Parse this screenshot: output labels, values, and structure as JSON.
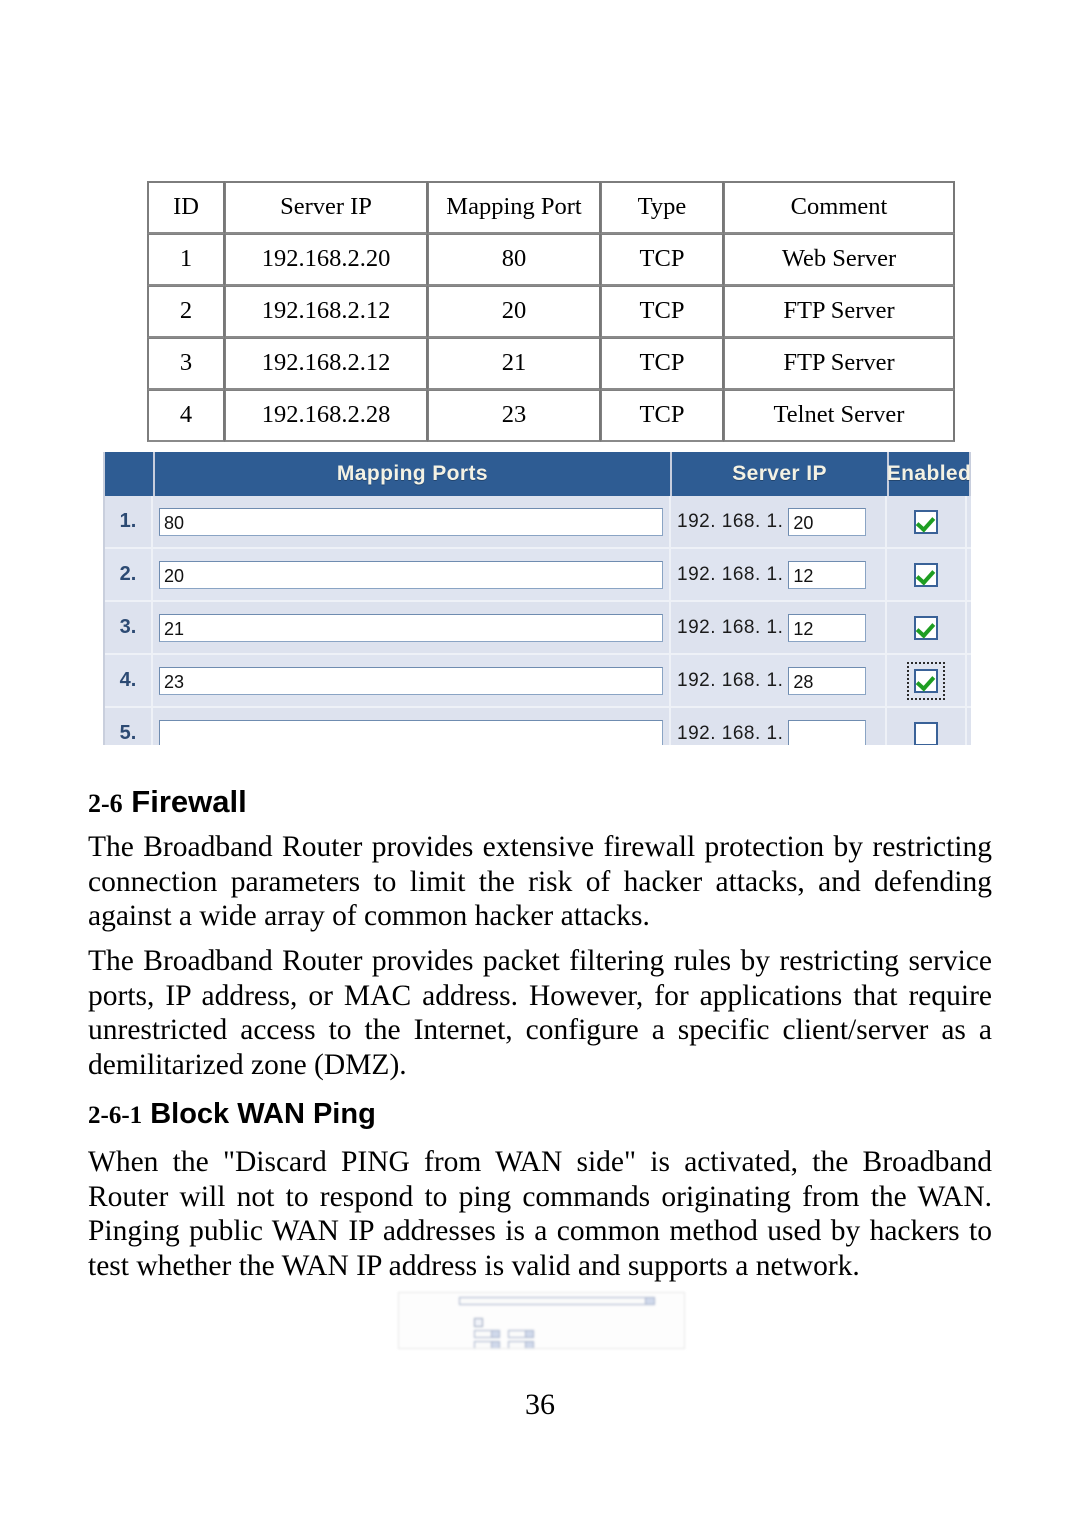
{
  "document": {
    "page_number": "36"
  },
  "summary_table": {
    "headers": [
      "ID",
      "Server IP",
      "Mapping Port",
      "Type",
      "Comment"
    ],
    "rows": [
      [
        "1",
        "192.168.2.20",
        "80",
        "TCP",
        "Web Server"
      ],
      [
        "2",
        "192.168.2.12",
        "20",
        "TCP",
        "FTP Server"
      ],
      [
        "3",
        "192.168.2.12",
        "21",
        "TCP",
        "FTP Server"
      ],
      [
        "4",
        "192.168.2.28",
        "23",
        "TCP",
        "Telnet Server"
      ]
    ]
  },
  "router_ui": {
    "colors": {
      "header_blue": "#2e5c93",
      "row_background": "#dfe4f0",
      "check_green": "#1e9e22",
      "header_text": "#f4f2e4"
    },
    "headers": {
      "number": "",
      "mapping_ports": "Mapping Ports",
      "server_ip": "Server IP",
      "enabled": "Enabled"
    },
    "ip_prefix": "192. 168. 1.",
    "rows": [
      {
        "index": "1.",
        "mapping_port": "80",
        "last_octet": "20",
        "enabled": true,
        "focused": false
      },
      {
        "index": "2.",
        "mapping_port": "20",
        "last_octet": "12",
        "enabled": true,
        "focused": false
      },
      {
        "index": "3.",
        "mapping_port": "21",
        "last_octet": "12",
        "enabled": true,
        "focused": false
      },
      {
        "index": "4.",
        "mapping_port": "23",
        "last_octet": "28",
        "enabled": true,
        "focused": true
      },
      {
        "index": "5.",
        "mapping_port": "",
        "last_octet": "",
        "enabled": false,
        "focused": false
      }
    ]
  },
  "section_firewall": {
    "number": "2-6",
    "title": "Firewall",
    "paragraph_1": "The Broadband Router provides extensive firewall protection by restricting connection parameters to limit the risk of hacker attacks, and defending against a wide array of common hacker attacks.",
    "paragraph_2": "The Broadband Router provides packet filtering rules by restricting service ports, IP address, or MAC address. However, for applications that require unrestricted access to the Internet, configure a specific client/server as a demilitarized zone (DMZ)."
  },
  "section_block_wan_ping": {
    "number": "2-6-1",
    "title": "Block WAN Ping",
    "paragraph_1": "When the \"Discard PING from WAN side\" is activated, the Broadband Router will not to respond to ping commands originating from the WAN. Pinging public WAN IP addresses is a common method used by hackers to test whether the WAN IP address is valid and supports a network."
  },
  "bottom_thumbnail": {
    "legible": false,
    "select_row_label": "",
    "select_value": "",
    "section_label": "",
    "field_labels": [
      "",
      "",
      ""
    ]
  }
}
